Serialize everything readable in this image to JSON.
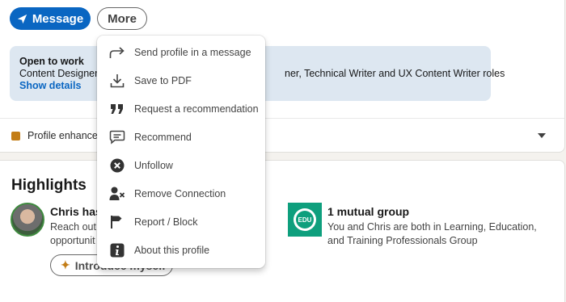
{
  "profile_actions": {
    "message_label": "Message",
    "more_label": "More"
  },
  "open_to_work": {
    "title": "Open to work",
    "roles_left": "Content Designer,",
    "roles_right": "ner, Technical Writer and UX Content Writer roles",
    "show_details": "Show details"
  },
  "profile_enhanced": {
    "label": "Profile enhanced"
  },
  "highlights": {
    "title": "Highlights",
    "person_name_partial": "Chris has",
    "person_desc_line1": "Reach out",
    "person_desc_line2": "opportunit",
    "intro_button_label": "Introduce myself",
    "group_logo_text": "EDU",
    "group_title": "1 mutual group",
    "group_desc": "You and Chris are both in Learning, Education, and Training Professionals Group"
  },
  "more_menu": {
    "items": [
      {
        "label": "Send profile in a message",
        "icon": "share-arrow-icon"
      },
      {
        "label": "Save to PDF",
        "icon": "download-icon"
      },
      {
        "label": "Request a recommendation",
        "icon": "quote-icon"
      },
      {
        "label": "Recommend",
        "icon": "speech-bubble-icon"
      },
      {
        "label": "Unfollow",
        "icon": "close-circle-icon"
      },
      {
        "label": "Remove Connection",
        "icon": "remove-person-icon"
      },
      {
        "label": "Report / Block",
        "icon": "flag-icon"
      },
      {
        "label": "About this profile",
        "icon": "info-icon"
      }
    ]
  },
  "colors": {
    "primary": "#0a66c2",
    "open_to_work_bg": "#dde7f1",
    "group_logo": "#0e9f7d",
    "premium_gold": "#c37d16"
  }
}
